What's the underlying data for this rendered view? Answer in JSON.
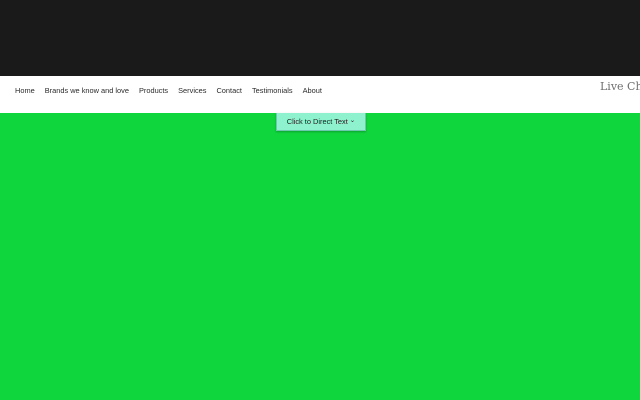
{
  "nav": {
    "items": [
      {
        "label": "Home"
      },
      {
        "label": "Brands we know and love"
      },
      {
        "label": "Products"
      },
      {
        "label": "Services"
      },
      {
        "label": "Contact"
      },
      {
        "label": "Testimonials"
      },
      {
        "label": "About"
      }
    ],
    "live_chat_label": "Live Chat"
  },
  "direct_text_button": {
    "label": "Click to Direct Text",
    "icon": "chevron-down-icon",
    "color": "#8ff2cf"
  },
  "colors": {
    "header_band": "#1b1a1b",
    "navbar": "#ffffff",
    "main_background": "#10d63d"
  }
}
